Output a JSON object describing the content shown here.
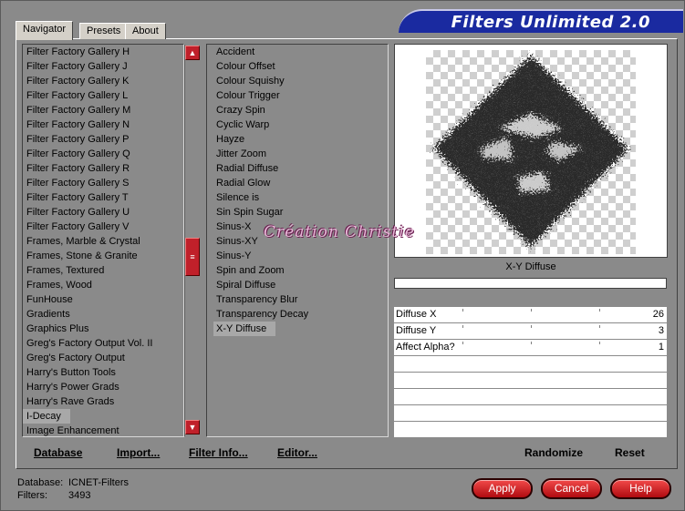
{
  "app": {
    "title": "Filters Unlimited 2.0"
  },
  "tabs": [
    {
      "label": "Navigator",
      "active": true
    },
    {
      "label": "Presets",
      "active": false
    },
    {
      "label": "About",
      "active": false
    }
  ],
  "categories": {
    "items": [
      "Filter Factory Gallery H",
      "Filter Factory Gallery J",
      "Filter Factory Gallery K",
      "Filter Factory Gallery L",
      "Filter Factory Gallery M",
      "Filter Factory Gallery N",
      "Filter Factory Gallery P",
      "Filter Factory Gallery Q",
      "Filter Factory Gallery R",
      "Filter Factory Gallery S",
      "Filter Factory Gallery T",
      "Filter Factory Gallery U",
      "Filter Factory Gallery V",
      "Frames, Marble & Crystal",
      "Frames, Stone & Granite",
      "Frames, Textured",
      "Frames, Wood",
      "FunHouse",
      "Gradients",
      "Graphics Plus",
      "Greg's Factory Output Vol. II",
      "Greg's Factory Output",
      "Harry's Button Tools",
      "Harry's Power Grads",
      "Harry's Rave Grads",
      "I-Decay",
      "Image Enhancement"
    ],
    "selected": "I-Decay"
  },
  "filters": {
    "items": [
      "Accident",
      "Colour Offset",
      "Colour Squishy",
      "Colour Trigger",
      "Crazy Spin",
      "Cyclic Warp",
      "Hayze",
      "Jitter Zoom",
      "Radial Diffuse",
      "Radial Glow",
      "Silence is",
      "Sin Spin Sugar",
      "Sinus-X",
      "Sinus-XY",
      "Sinus-Y",
      "Spin and Zoom",
      "Spiral Diffuse",
      "Transparency Blur",
      "Transparency Decay",
      "X-Y Diffuse"
    ],
    "selected": "X-Y Diffuse"
  },
  "preview": {
    "filter_name": "X-Y Diffuse"
  },
  "params": [
    {
      "name": "Diffuse X",
      "value": "26"
    },
    {
      "name": "Diffuse Y",
      "value": "3"
    },
    {
      "name": "Affect Alpha?",
      "value": "1"
    }
  ],
  "actions": {
    "database": "Database",
    "import": "Import...",
    "filter_info": "Filter Info...",
    "editor": "Editor...",
    "randomize": "Randomize",
    "reset": "Reset"
  },
  "status": {
    "database_label": "Database:",
    "database_value": "ICNET-Filters",
    "filters_label": "Filters:",
    "filters_value": "3493"
  },
  "buttons": {
    "apply": "Apply",
    "cancel": "Cancel",
    "help": "Help"
  },
  "watermark": "Création Christie",
  "colors": {
    "banner": "#1a2aa0",
    "button_red": "#c0202a",
    "panel": "#8a8a8a"
  }
}
